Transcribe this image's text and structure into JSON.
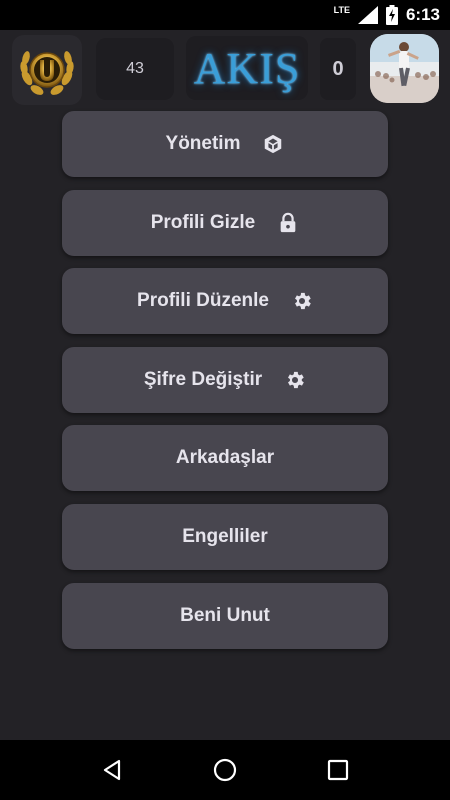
{
  "status_bar": {
    "network": "LTE",
    "time": "6:13"
  },
  "header": {
    "logo_icon": "laurel-u-logo-icon",
    "left_count": "43",
    "title": "AKIŞ",
    "right_count": "0",
    "avatar_icon": "profile-photo"
  },
  "menu": {
    "items": [
      {
        "label": "Yönetim",
        "icon": "cube-icon"
      },
      {
        "label": "Profili Gizle",
        "icon": "lock-icon"
      },
      {
        "label": "Profili Düzenle",
        "icon": "gear-icon"
      },
      {
        "label": "Şifre Değiştir",
        "icon": "gear-icon"
      },
      {
        "label": "Arkadaşlar",
        "icon": ""
      },
      {
        "label": "Engelliler",
        "icon": ""
      },
      {
        "label": "Beni Unut",
        "icon": ""
      }
    ]
  },
  "nav_bar": {
    "back_icon": "back-triangle-icon",
    "home_icon": "home-circle-icon",
    "recents_icon": "recents-square-icon"
  },
  "colors": {
    "background": "#232226",
    "button": "#48464f",
    "title_accent": "#3a9ed8"
  }
}
